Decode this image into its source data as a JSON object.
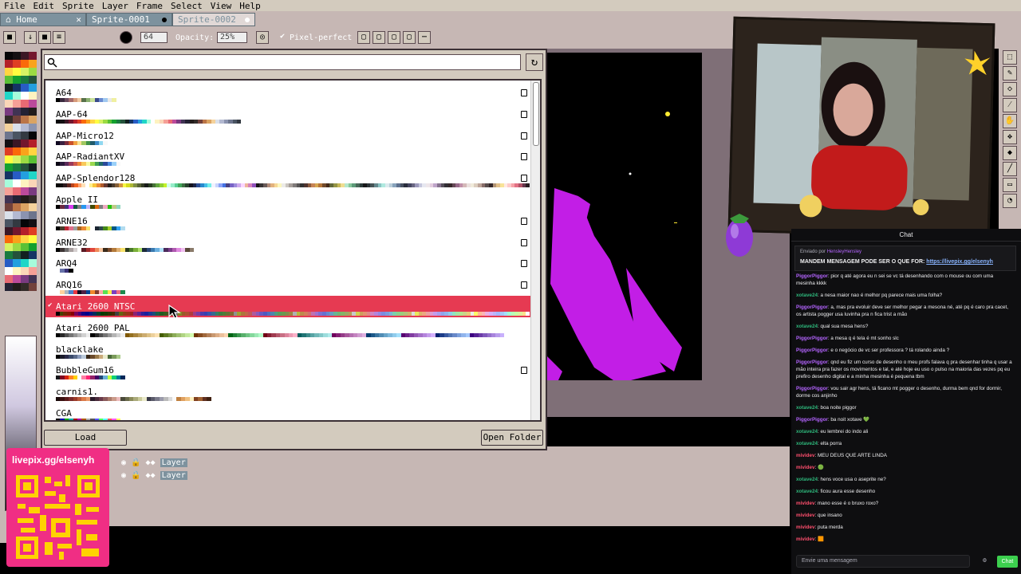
{
  "menu": [
    "File",
    "Edit",
    "Sprite",
    "Layer",
    "Frame",
    "Select",
    "View",
    "Help"
  ],
  "tabs": [
    {
      "label": "Home",
      "close": "✕"
    },
    {
      "label": "Sprite-0001"
    },
    {
      "label": "Sprite-0002"
    }
  ],
  "toolbar": {
    "size_value": "64",
    "opacity_label": "Opacity:",
    "opacity_value": "25%",
    "pixel_perfect_label": "Pixel-perfect",
    "pixel_perfect_checked": true
  },
  "dialog": {
    "search_placeholder": "",
    "load_label": "Load",
    "open_folder_label": "Open Folder",
    "palettes": [
      {
        "name": "A64",
        "colors": [
          "#000",
          "#3a2a3e",
          "#6a4a5e",
          "#a46a6a",
          "#d69a7a",
          "#f0c8a0",
          "#58704a",
          "#8ab070",
          "#c8e09a",
          "#3a4a8a",
          "#6a8ad0",
          "#a0c8f0",
          "#e8e8e8",
          "#f0f0a0"
        ],
        "fav": true
      },
      {
        "name": "AAP-64",
        "colors": [
          "#060608",
          "#141013",
          "#3b1725",
          "#73172d",
          "#b4202a",
          "#df3e23",
          "#fa6a0a",
          "#f9a31b",
          "#ffd541",
          "#fffc40",
          "#d6f264",
          "#9cdb43",
          "#59c135",
          "#14a02e",
          "#1a7a3e",
          "#24523b",
          "#122020",
          "#143464",
          "#285cc4",
          "#249fde",
          "#20d6c7",
          "#a6fcdb",
          "#ffffff",
          "#fef3c0",
          "#fad6b8",
          "#f5a097",
          "#e86a73",
          "#bc4a9b",
          "#793a80",
          "#403353",
          "#242234",
          "#221c1a",
          "#322b28",
          "#71413b",
          "#bb7547",
          "#dba463",
          "#f4d29c",
          "#dae0ea",
          "#b3b9d1",
          "#8b93af",
          "#6d758d",
          "#4a5462",
          "#333941"
        ],
        "fav": true
      },
      {
        "name": "AAP-Micro12",
        "colors": [
          "#100820",
          "#3a2040",
          "#7a2a3a",
          "#c8502a",
          "#f0a040",
          "#f8e090",
          "#a0c860",
          "#409048",
          "#205a6a",
          "#3a8ac8",
          "#90d8f0",
          "#f8f8f8"
        ],
        "fav": true
      },
      {
        "name": "AAP-RadiantXV",
        "colors": [
          "#0a0614",
          "#2a1a3a",
          "#5a2a5a",
          "#9a3a5a",
          "#d05a4a",
          "#f08a3a",
          "#f8c85a",
          "#f8f8a0",
          "#9ad850",
          "#40a050",
          "#206a6a",
          "#2a4a9a",
          "#4a8ae0",
          "#9ad0f8",
          "#f8f8f8"
        ],
        "fav": true
      },
      {
        "name": "AAP-Splendor128",
        "colors": [
          "#050403",
          "#0e0c0c",
          "#2d1b1e",
          "#612721",
          "#b9451d",
          "#f1641f",
          "#fca570",
          "#ffe0b7",
          "#ffffff",
          "#fff089",
          "#f8c53a",
          "#e88a36",
          "#b05b2c",
          "#673931",
          "#271f1b",
          "#4c3d2e",
          "#855f39",
          "#d39741",
          "#f8f644",
          "#d5dc1d",
          "#adb834",
          "#7f8e44",
          "#586335",
          "#333c24",
          "#181c19",
          "#293f21",
          "#477238",
          "#61a53f",
          "#8fd032",
          "#c4f129",
          "#d0ffea",
          "#97edca",
          "#59cf93",
          "#42a459",
          "#3d6f43",
          "#27412d",
          "#14121d",
          "#1b2447",
          "#2b4e95",
          "#2789cd",
          "#42bfe8",
          "#73efe8",
          "#f1f2ff",
          "#c9d4fd",
          "#8aa1f6",
          "#4572e3",
          "#494182",
          "#7864c6",
          "#9c8bdb",
          "#ceaaed",
          "#fad6ff",
          "#eeb59c",
          "#d480bb",
          "#9052bc",
          "#171516",
          "#373334",
          "#695b59",
          "#b28b78",
          "#e2b27e",
          "#f6d896",
          "#fcf7be",
          "#ecebe7",
          "#cbc6c1",
          "#a69e9a",
          "#807b7a",
          "#595757",
          "#323232",
          "#4f342f",
          "#8c5b3e",
          "#c68556",
          "#d6a851",
          "#b47538",
          "#724b2c",
          "#452a1b",
          "#61683a",
          "#939446",
          "#c6b858",
          "#efdd91",
          "#b5e7cb",
          "#86c69a",
          "#5d9b79",
          "#486859",
          "#2c3b39",
          "#171819",
          "#2c3438",
          "#465456",
          "#64878c",
          "#8ac4c3",
          "#afe9df",
          "#dceaee",
          "#b8ccd8",
          "#88a3bc",
          "#5e718e",
          "#485262",
          "#282c3c",
          "#464762",
          "#696682",
          "#9a97b9",
          "#c5c7dd",
          "#e6e7f0",
          "#eee6ea",
          "#e3cddf",
          "#bfa5c9",
          "#87738f",
          "#564f5b",
          "#322f35",
          "#36282b",
          "#654956",
          "#966888",
          "#c090a9",
          "#d4b8b8",
          "#eae0dd",
          "#f1ebdb",
          "#ddcebf",
          "#bda499",
          "#886e6a",
          "#594d4d",
          "#33272a",
          "#b29476",
          "#e1bf89",
          "#f8e398",
          "#ffe9e3",
          "#fdc9c9",
          "#f6a2a8",
          "#e27285",
          "#b25266",
          "#64364b",
          "#2a1e23"
        ],
        "fav": true
      },
      {
        "name": "Apple II",
        "colors": [
          "#000000",
          "#6c2940",
          "#403578",
          "#d93cf0",
          "#135740",
          "#808080",
          "#2697f0",
          "#bfb4f8",
          "#404b07",
          "#d9680f",
          "#808080",
          "#eca8bf",
          "#26c30f",
          "#bfca87",
          "#93d6bf",
          "#ffffff"
        ],
        "fav": false
      },
      {
        "name": "ARNE16",
        "colors": [
          "#000000",
          "#493c2b",
          "#be2633",
          "#e06f8b",
          "#9d9d9d",
          "#a46422",
          "#eb8931",
          "#f7e26b",
          "#ffffff",
          "#1b2632",
          "#2f484e",
          "#44891a",
          "#a3ce27",
          "#005784",
          "#31a2f2",
          "#b2dcef"
        ],
        "fav": true
      },
      {
        "name": "ARNE32",
        "colors": [
          "#000000",
          "#3d3434",
          "#6e6c6c",
          "#a89f9f",
          "#d6d0d0",
          "#ffffff",
          "#5a1a23",
          "#a12a2a",
          "#e0473c",
          "#f08a5a",
          "#f7c6a0",
          "#3a2a1a",
          "#7a4a2a",
          "#b47a3a",
          "#e0b070",
          "#f7e26b",
          "#2a3a1a",
          "#4a7a2a",
          "#7ab03a",
          "#b0e06b",
          "#1a2a3a",
          "#2a4a7a",
          "#3a7ab0",
          "#6bb0e0",
          "#b0e0f7",
          "#4a2a5a",
          "#7a3a8a",
          "#b05ab0",
          "#e08ae0",
          "#f0c0f0",
          "#5a4a3a",
          "#8a7a6a"
        ],
        "fav": true
      },
      {
        "name": "ARQ4",
        "colors": [
          "#ffffff",
          "#6772a9",
          "#3a3277",
          "#000000"
        ],
        "fav": true
      },
      {
        "name": "ARQ16",
        "colors": [
          "#ffffff",
          "#ffd19d",
          "#aeb5bd",
          "#4d80c9",
          "#e93841",
          "#100820",
          "#511e43",
          "#054494",
          "#f1892d",
          "#823e2c",
          "#ffa9a9",
          "#5ae150",
          "#ffe947",
          "#7d3ebf",
          "#eb6c82",
          "#1e8a4c"
        ],
        "fav": true
      },
      {
        "name": "Atari 2600 NTSC",
        "colors": [
          "#000000",
          "#444400",
          "#702800",
          "#841800",
          "#880000",
          "#78005c",
          "#480078",
          "#140084",
          "#000088",
          "#00187c",
          "#002c5c",
          "#003c2c",
          "#003c00",
          "#143800",
          "#2c3000",
          "#442800",
          "#404040",
          "#646410",
          "#844414",
          "#983418",
          "#9c2020",
          "#8c2074",
          "#602090",
          "#302098",
          "#1c209c",
          "#1c3890",
          "#1c4c78",
          "#1c5c48",
          "#205c20",
          "#345c1c",
          "#4c501c",
          "#644818",
          "#6c6c6c",
          "#848424",
          "#985c28",
          "#ac5030",
          "#b03c3c",
          "#a03c88",
          "#783ca4",
          "#4c3cac",
          "#3840b0",
          "#3854a8",
          "#386890",
          "#387c64",
          "#407c40",
          "#507c38",
          "#687034",
          "#846830",
          "#909090",
          "#a0a034",
          "#ac783c",
          "#c06848",
          "#c05858",
          "#b0589c",
          "#8c58b8",
          "#6858c0",
          "#5058c0",
          "#5070bc",
          "#5084ac",
          "#509c80",
          "#5c9c5c",
          "#6c9850",
          "#848c4c",
          "#a08444",
          "#b0b0b0",
          "#b8b840",
          "#bc8c4c",
          "#d0805c",
          "#d07070",
          "#c070b0",
          "#a070cc",
          "#7c70d0",
          "#6870d0",
          "#6888cc",
          "#689cc0",
          "#68b494",
          "#74b474",
          "#84b468",
          "#9ca864",
          "#b89c58",
          "#c8c8c8",
          "#d0d050",
          "#cca05c",
          "#e09470",
          "#e08888",
          "#d084c0",
          "#b484dc",
          "#9488e0",
          "#7c8ce0",
          "#7c9cdc",
          "#7cb4d4",
          "#7cd0ac",
          "#8cd08c",
          "#9ccc7c",
          "#b4c078",
          "#d0b46c",
          "#dcdcdc",
          "#e8e85c",
          "#dcb468",
          "#eca880",
          "#eca0a0",
          "#dc9cd0",
          "#c49cec",
          "#a8a0ec",
          "#90a4ec",
          "#90b4ec",
          "#90cce8",
          "#90e4c0",
          "#a4e4a4",
          "#b4e490",
          "#ccd488",
          "#e8cc7c",
          "#ececec",
          "#fcfc68",
          "#fcbc94",
          "#fcb4b4",
          "#ecb0e0",
          "#d4b0fc",
          "#bcb4fc",
          "#a4b8fc",
          "#a4c8fc",
          "#a4e0fc",
          "#a4fcd4",
          "#b8fcb8",
          "#c8fca4",
          "#e0ec9c",
          "#fce08c",
          "#ffffff"
        ],
        "fav": false,
        "selected": true
      },
      {
        "name": "Atari 2600 PAL",
        "colors": [
          "#000000",
          "#282828",
          "#505050",
          "#747474",
          "#949494",
          "#b4b4b4",
          "#d0d0d0",
          "#ececec",
          "#000000",
          "#282828",
          "#505050",
          "#747474",
          "#949494",
          "#b4b4b4",
          "#d0d0d0",
          "#ececec",
          "#805800",
          "#947020",
          "#a8843c",
          "#bc9c58",
          "#ccac70",
          "#dcc084",
          "#ecd09c",
          "#fce0b0",
          "#445c00",
          "#5c7820",
          "#74903c",
          "#8cac58",
          "#a0c070",
          "#b0d484",
          "#c4e89c",
          "#d4fcb0",
          "#703400",
          "#884c20",
          "#a0683c",
          "#b48058",
          "#c89870",
          "#dcac84",
          "#ecc09c",
          "#fcd4b0",
          "#006414",
          "#208034",
          "#3c9850",
          "#58b06c",
          "#70c484",
          "#84d89c",
          "#9ce8b4",
          "#b0fcc8",
          "#700014",
          "#882034",
          "#a03c50",
          "#b4586c",
          "#c87084",
          "#dc849c",
          "#ec9cb4",
          "#fcb0c8",
          "#005c5c",
          "#207474",
          "#3c8c8c",
          "#58a4a4",
          "#70b8b8",
          "#84c8c8",
          "#9cdcdc",
          "#b0ecec",
          "#70005c",
          "#842074",
          "#943c88",
          "#a8589c",
          "#b470b0",
          "#c484c0",
          "#d09cd0",
          "#e0b0e0",
          "#003c70",
          "#1c5888",
          "#3874a0",
          "#508cb4",
          "#68a4c8",
          "#7cb8dc",
          "#90ccec",
          "#a4e0fc",
          "#580070",
          "#6c2088",
          "#803ca0",
          "#9458b4",
          "#a470c8",
          "#b484dc",
          "#c49cec",
          "#d4b0fc",
          "#002070",
          "#1c3c88",
          "#3858a0",
          "#5074b4",
          "#6888c8",
          "#7ca0dc",
          "#90b4ec",
          "#a4c8fc",
          "#3c0080",
          "#542094",
          "#6c3ca8",
          "#8058bc",
          "#9470cc",
          "#a884dc",
          "#b89cec",
          "#c8b0fc"
        ],
        "fav": false
      },
      {
        "name": "blacklake",
        "colors": [
          "#000000",
          "#1a1a2a",
          "#2a2a4a",
          "#3a4a6a",
          "#5a6a8a",
          "#8a9aba",
          "#bacada",
          "#3a2a1a",
          "#6a4a2a",
          "#9a7a4a",
          "#caaa7a",
          "#eaeaca",
          "#4a6a3a",
          "#7a9a5a",
          "#aaca8a"
        ],
        "fav": false
      },
      {
        "name": "BubbleGum16",
        "colors": [
          "#16171a",
          "#7f0622",
          "#d62411",
          "#ff8426",
          "#ffd100",
          "#fafdff",
          "#ff80a4",
          "#ff2674",
          "#94216a",
          "#430067",
          "#234975",
          "#68aed4",
          "#bfff3c",
          "#10d275",
          "#007899",
          "#002859"
        ],
        "fav": true
      },
      {
        "name": "carnis1.",
        "colors": [
          "#1a0a0a",
          "#3a1010",
          "#5a1a1a",
          "#7a2a2a",
          "#9a3a2a",
          "#ba5a3a",
          "#da7a4a",
          "#ea9a6a",
          "#2a1a2a",
          "#4a2a3a",
          "#6a3a4a",
          "#8a5a5a",
          "#aa7a6a",
          "#ca9a8a",
          "#eababa",
          "#4a4a3a",
          "#6a6a4a",
          "#8a8a5a",
          "#aaaa7a",
          "#caca9a",
          "#eaeaca",
          "#3a3a4a",
          "#5a5a6a",
          "#7a7a8a",
          "#9a9aaa",
          "#bababa",
          "#dadada",
          "#fafafa",
          "#c08040",
          "#e0a060",
          "#f0c080",
          "#fff0c0",
          "#804020",
          "#a06030",
          "#603020",
          "#402010"
        ],
        "fav": false
      },
      {
        "name": "CGA",
        "colors": [
          "#000000",
          "#0000aa",
          "#00aa00",
          "#00aaaa",
          "#aa0000",
          "#aa00aa",
          "#aa5500",
          "#aaaaaa",
          "#555555",
          "#5555ff",
          "#55ff55",
          "#55ffff",
          "#ff5555",
          "#ff55ff",
          "#ffff55",
          "#ffffff"
        ],
        "fav": false
      }
    ]
  },
  "layers": [
    {
      "label": "Layer"
    },
    {
      "label": "Layer"
    }
  ],
  "stream": {
    "qr_title": "livepix.gg/elsenyh",
    "chat_header": "Chat",
    "pinned_by_prefix": "Enviado por",
    "pinned_by_user": "HensleyHensley",
    "pinned_message": "MANDEM MENSAGEM PODE SER O QUE FOR:",
    "pinned_link": "https://livepix.gg/elsenyh",
    "messages": [
      {
        "user": "PiggorPiggor",
        "cls": "u-pig",
        "text": "pior q até agora eu n sei se vc tá desenhando com o mouse ou com uma mesinha kkkk"
      },
      {
        "user": "xotave24",
        "cls": "u-xot",
        "text": "a nesa maior nao é melhor pq parece mais uma folha?"
      },
      {
        "user": "PiggorPiggor",
        "cls": "u-pig",
        "text": "a, mas pra evoluir deve ser melhor pegar a mesona né, até pq é caro pra cacet, os artista pogger usa luvinha pra n fica trist a mão"
      },
      {
        "user": "xotave24",
        "cls": "u-xot",
        "text": "qual sua mesa hens?"
      },
      {
        "user": "PiggorPiggor",
        "cls": "u-pig",
        "text": "a mesa q é tela é mt sonho slc"
      },
      {
        "user": "PiggorPiggor",
        "cls": "u-pig",
        "text": "e o negócio de vc ser professora ? tá rolando ainda ?"
      },
      {
        "user": "PiggorPiggor",
        "cls": "u-pig",
        "text": "qnd eu fiz um curso de desenho o meu profs falava q pra desenhar tinha q usar a mão inteira pra fazer os movimentos e tal, e até hoje eu uso o pulso na maioria das vezes pq eu prefiro desenho digital e a minha mesinha é pequena tbm"
      },
      {
        "user": "PiggorPiggor",
        "cls": "u-pig",
        "text": "vou sair agr hens, tá ficano mt pogger o desenho, durma bem qnd for dormir, dorme cos anjinho"
      },
      {
        "user": "xotave24",
        "cls": "u-xot",
        "text": "boa noite piggor"
      },
      {
        "user": "PiggorPiggor",
        "cls": "u-pig",
        "text": "ba noit xotave 💚"
      },
      {
        "user": "xotave24",
        "cls": "u-xot",
        "text": "eu lembrei do indo ali"
      },
      {
        "user": "xotave24",
        "cls": "u-xot",
        "text": "elta porra"
      },
      {
        "user": "mividev",
        "cls": "u-miv",
        "text": "MEU DEUS QUE ARTE LINDA"
      },
      {
        "user": "mividev",
        "cls": "u-miv",
        "text": "🟢"
      },
      {
        "user": "xotave24",
        "cls": "u-xot",
        "text": "hens voce usa o aseprite ne?"
      },
      {
        "user": "xotave24",
        "cls": "u-xot",
        "text": "ficou aura esse desenho"
      },
      {
        "user": "mividev",
        "cls": "u-miv",
        "text": "mano esse é o bruxo roxo?"
      },
      {
        "user": "mividev",
        "cls": "u-miv",
        "text": "que insano"
      },
      {
        "user": "mividev",
        "cls": "u-miv",
        "text": "puta merda"
      },
      {
        "user": "mividev",
        "cls": "u-miv",
        "text": "🟧"
      }
    ],
    "chat_placeholder": "Envie uma mensagem",
    "chat_button": "Chat"
  },
  "colors": {
    "ui_bg": "#c6b7b4",
    "ui_light": "#d3cbbe",
    "selection": "#e63a52",
    "qr_bg": "#f02e84"
  }
}
